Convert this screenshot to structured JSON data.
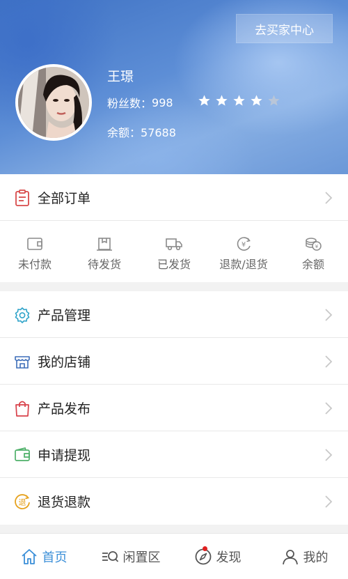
{
  "header": {
    "buyer_center_button": "去买家中心",
    "user_name": "王璟",
    "fans_label": "粉丝数：",
    "fans_count": "998",
    "rating": 4,
    "rating_max": 5,
    "balance_label": "余额：",
    "balance_value": "57688"
  },
  "orders": {
    "all_orders_label": "全部订单",
    "statuses": [
      {
        "label": "未付款",
        "icon": "wallet-icon"
      },
      {
        "label": "待发货",
        "icon": "package-icon"
      },
      {
        "label": "已发货",
        "icon": "truck-icon"
      },
      {
        "label": "退款/退货",
        "icon": "yen-refund-icon"
      },
      {
        "label": "余额",
        "icon": "coins-icon"
      }
    ]
  },
  "menu": {
    "items": [
      {
        "label": "产品管理",
        "icon": "gear-icon"
      },
      {
        "label": "我的店铺",
        "icon": "shop-icon"
      },
      {
        "label": "产品发布",
        "icon": "shopping-bag-icon"
      },
      {
        "label": "申请提现",
        "icon": "wallet-withdraw-icon"
      },
      {
        "label": "退货退款",
        "icon": "return-icon",
        "icon_text": "退"
      }
    ]
  },
  "tabbar": {
    "tabs": [
      {
        "label": "首页",
        "icon": "home-icon",
        "active": true
      },
      {
        "label": "闲置区",
        "icon": "idle-list-icon",
        "active": false
      },
      {
        "label": "发现",
        "icon": "compass-icon",
        "active": false,
        "badge": true
      },
      {
        "label": "我的",
        "icon": "person-icon",
        "active": false
      }
    ]
  },
  "colors": {
    "accent": "#3b8fd8",
    "star_filled": "#ffffff",
    "star_empty": "#b9c6d8",
    "badge": "#e02020"
  }
}
